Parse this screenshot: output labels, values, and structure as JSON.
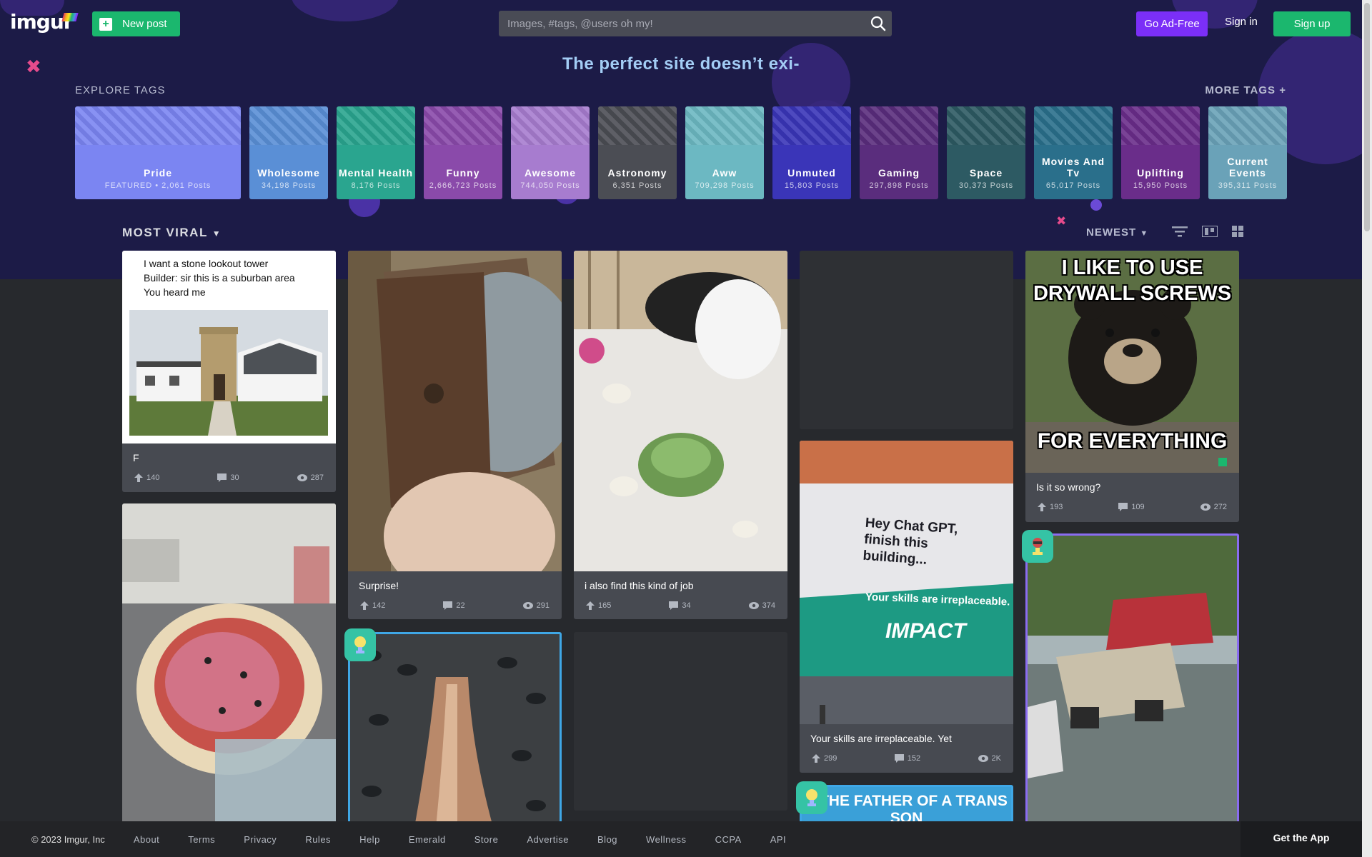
{
  "header": {
    "logo": "imgur",
    "new_post": "New post",
    "search_placeholder": "Images, #tags, @users oh my!",
    "ad_free": "Go Ad-Free",
    "sign_in": "Sign in",
    "sign_up": "Sign up"
  },
  "banner": {
    "tagline": "The perfect site doesn’t exi-"
  },
  "explore": {
    "heading": "EXPLORE TAGS",
    "more": "MORE TAGS +",
    "tags": [
      {
        "name": "Pride",
        "count": "FEATURED • 2,061 Posts",
        "color": "#7b85f2"
      },
      {
        "name": "Wholesome",
        "count": "34,198 Posts",
        "color": "#5a8fd6"
      },
      {
        "name": "Mental Health",
        "count": "8,176 Posts",
        "color": "#2aa58f"
      },
      {
        "name": "Funny",
        "count": "2,666,723 Posts",
        "color": "#8a4aaa"
      },
      {
        "name": "Awesome",
        "count": "744,050 Posts",
        "color": "#a77ccf"
      },
      {
        "name": "Astronomy",
        "count": "6,351 Posts",
        "color": "#4b4d54"
      },
      {
        "name": "Aww",
        "count": "709,298 Posts",
        "color": "#6cb8c2"
      },
      {
        "name": "Unmuted",
        "count": "15,803 Posts",
        "color": "#3a35b8"
      },
      {
        "name": "Gaming",
        "count": "297,898 Posts",
        "color": "#5a2d7d"
      },
      {
        "name": "Space",
        "count": "30,373 Posts",
        "color": "#2d5a63"
      },
      {
        "name": "Movies And Tv",
        "count": "65,017 Posts",
        "color": "#2a6f8b"
      },
      {
        "name": "Uplifting",
        "count": "15,950 Posts",
        "color": "#6a2d8a"
      },
      {
        "name": "Current Events",
        "count": "395,311 Posts",
        "color": "#6aa2b8"
      }
    ]
  },
  "sort": {
    "left": "MOST VIRAL",
    "right": "NEWEST"
  },
  "posts": [
    {
      "title": "F",
      "upvotes": "140",
      "comments": "30",
      "views": "287",
      "meme_text": "I want a stone lookout tower\nBuilder: sir this is a suburban area\nYou heard me"
    },
    {
      "title": "Surprise!",
      "upvotes": "142",
      "comments": "22",
      "views": "291"
    },
    {
      "title": "i also find this kind of job",
      "upvotes": "165",
      "comments": "34",
      "views": "374"
    },
    {
      "title": "Your skills are irreplaceable. Yet",
      "upvotes": "299",
      "comments": "152",
      "views": "2K",
      "sign_text": "Hey Chat GPT, finish this building...",
      "band_text": "Your skills are irreplaceable.",
      "brand": "IMPACT"
    },
    {
      "title": "Is it so wrong?",
      "upvotes": "193",
      "comments": "109",
      "views": "272",
      "meme_top": "I LIKE TO USE DRYWALL SCREWS",
      "meme_bottom": "FOR EVERYTHING"
    },
    {
      "meme_top": "S THE FATHER OF A TRANS SON"
    }
  ],
  "footer": {
    "copyright": "© 2023 Imgur, Inc",
    "links": [
      "About",
      "Terms",
      "Privacy",
      "Rules",
      "Help",
      "Emerald",
      "Store",
      "Advertise",
      "Blog",
      "Wellness",
      "CCPA",
      "API"
    ],
    "get_app": "Get the App"
  }
}
